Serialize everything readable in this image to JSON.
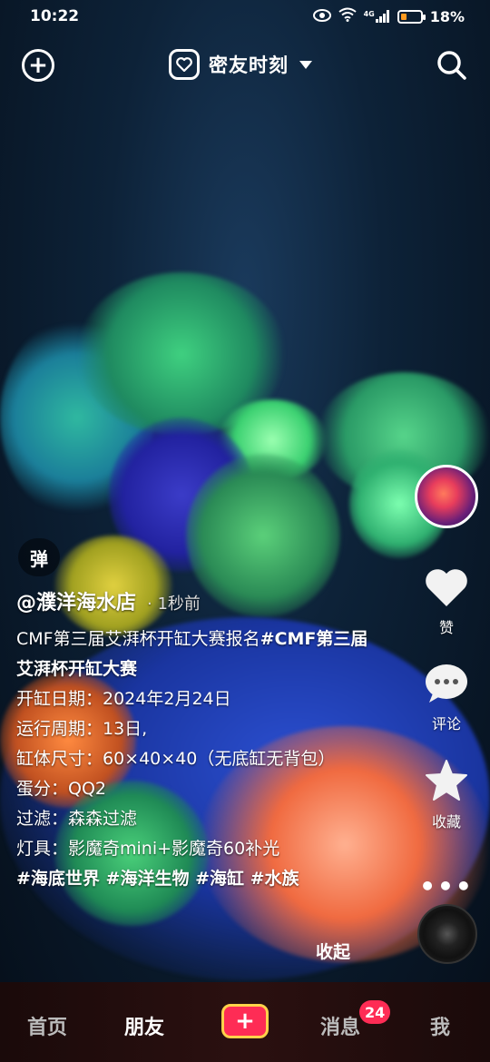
{
  "status_bar": {
    "time": "10:22",
    "battery_percent": "18%",
    "network_label": "4G"
  },
  "top_bar": {
    "title": "密友时刻",
    "title_icon": "heart-camera-icon",
    "left_icon": "plus-circle-icon",
    "right_icon": "search-icon"
  },
  "video": {
    "danmu_label": "弹"
  },
  "post": {
    "author": "@濮洋海水店",
    "time": "· 1秒前",
    "description_prefix": "CMF第三届艾湃杯开缸大赛报名",
    "description_tag": "#CMF第三届艾湃杯开缸大赛",
    "lines": [
      "开缸日期：2024年2月24日",
      "运行周期：13日,",
      "缸体尺寸：60×40×40（无底缸无背包）",
      "蛋分：QQ2",
      "过滤：森森过滤",
      "灯具：影魔奇mini+影魔奇60补光"
    ],
    "tags": "#海底世界 #海洋生物 #海缸 #水族",
    "collapse_label": "收起"
  },
  "actions": {
    "like_label": "赞",
    "comment_label": "评论",
    "favorite_label": "收藏",
    "more_label": "•••"
  },
  "bottom_nav": {
    "home": "首页",
    "friends": "朋友",
    "publish": "+",
    "messages": "消息",
    "messages_badge": "24",
    "me": "我"
  },
  "colors": {
    "accent": "#fe2c55",
    "publish_border": "#ffd24a"
  }
}
